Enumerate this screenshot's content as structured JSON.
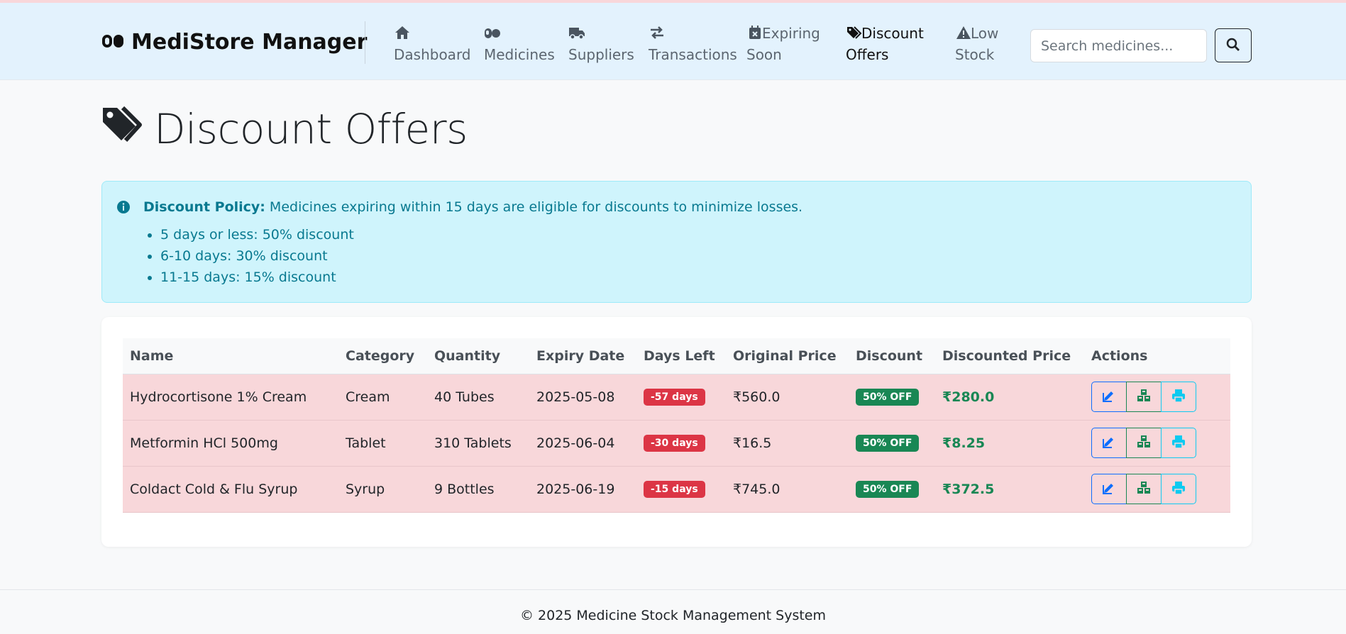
{
  "app": {
    "title": "MediStore Manager"
  },
  "nav": {
    "items": [
      {
        "label": "Dashboard",
        "icon": "home-icon"
      },
      {
        "label": "Medicines",
        "icon": "pills-icon"
      },
      {
        "label": "Suppliers",
        "icon": "truck-icon"
      },
      {
        "label": "Transactions",
        "icon": "exchange-icon"
      },
      {
        "label_line1": "Expiring",
        "label_line2": "Soon",
        "icon": "calendar-x-icon"
      },
      {
        "label_line1": "Discount",
        "label_line2": "Offers",
        "icon": "tags-icon",
        "active": true
      },
      {
        "label_line1": "Low",
        "label_line2": "Stock",
        "icon": "warning-icon"
      }
    ]
  },
  "search": {
    "placeholder": "Search medicines...",
    "value": ""
  },
  "page": {
    "title": "Discount Offers",
    "icon": "tags-icon"
  },
  "policy": {
    "heading": "Discount Policy:",
    "text": "Medicines expiring within 15 days are eligible for discounts to minimize losses.",
    "rules": [
      "5 days or less: 50% discount",
      "6-10 days: 30% discount",
      "11-15 days: 15% discount"
    ]
  },
  "table": {
    "headers": [
      "Name",
      "Category",
      "Quantity",
      "Expiry Date",
      "Days Left",
      "Original Price",
      "Discount",
      "Discounted Price",
      "Actions"
    ],
    "rows": [
      {
        "name": "Hydrocortisone 1% Cream",
        "category": "Cream",
        "quantity": "40 Tubes",
        "expiry": "2025-05-08",
        "days_left": "-57 days",
        "original_price": "₹560.0",
        "discount": "50% OFF",
        "discounted_price": "₹280.0"
      },
      {
        "name": "Metformin HCl 500mg",
        "category": "Tablet",
        "quantity": "310 Tablets",
        "expiry": "2025-06-04",
        "days_left": "-30 days",
        "original_price": "₹16.5",
        "discount": "50% OFF",
        "discounted_price": "₹8.25"
      },
      {
        "name": "Coldact Cold & Flu Syrup",
        "category": "Syrup",
        "quantity": "9 Bottles",
        "expiry": "2025-06-19",
        "days_left": "-15 days",
        "original_price": "₹745.0",
        "discount": "50% OFF",
        "discounted_price": "₹372.5"
      }
    ]
  },
  "footer": {
    "text": "© 2025 Medicine Stock Management System"
  },
  "colors": {
    "navbar_bg": "#e3f2fd",
    "alert_bg": "#cff4fc",
    "alert_text": "#087990",
    "row_bg": "#f8d7da",
    "danger": "#dc3545",
    "success": "#198754",
    "primary": "#0d6efd",
    "info": "#0dcaf0"
  }
}
